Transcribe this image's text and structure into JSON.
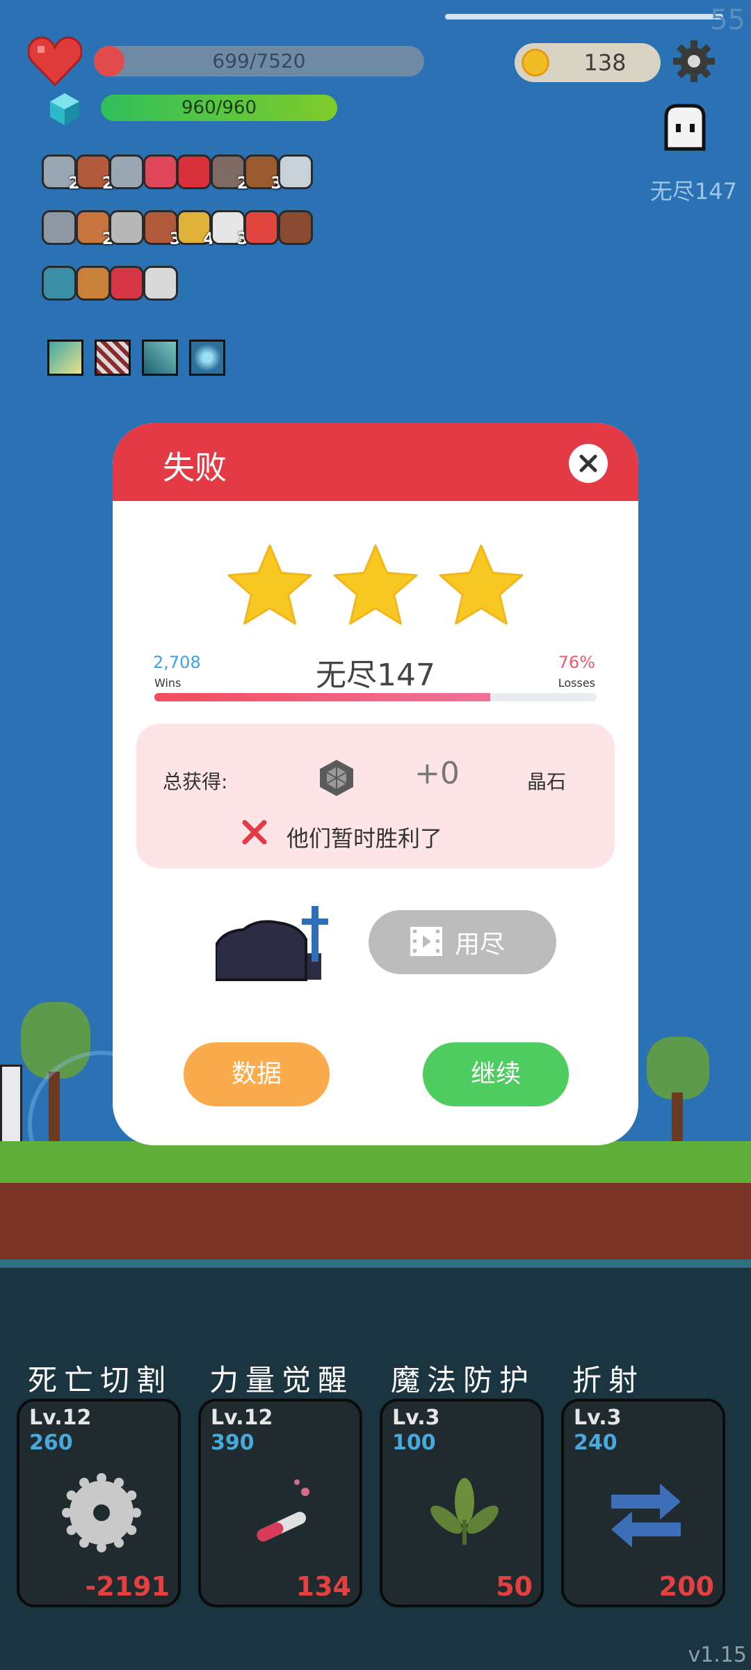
{
  "hud": {
    "fps": "55",
    "hp": {
      "text": "699/7520",
      "current": 699,
      "max": 7520,
      "color": "#e24b4b"
    },
    "mp": {
      "text": "960/960",
      "current": 960,
      "max": 960
    },
    "coins": "138",
    "level_name": "无尽147"
  },
  "items": {
    "row1": [
      {
        "icon": "sword-icon",
        "count": "2"
      },
      {
        "icon": "shield-icon",
        "count": "2"
      },
      {
        "icon": "sword-icon",
        "count": ""
      },
      {
        "icon": "watermelon-icon",
        "count": ""
      },
      {
        "icon": "apple-icon",
        "count": ""
      },
      {
        "icon": "mace-icon",
        "count": "2"
      },
      {
        "icon": "bow-icon",
        "count": "3"
      },
      {
        "icon": "arrow-icon",
        "count": ""
      }
    ],
    "row2": [
      {
        "icon": "axe-icon",
        "count": ""
      },
      {
        "icon": "bread-icon",
        "count": "2"
      },
      {
        "icon": "helmet-icon",
        "count": ""
      },
      {
        "icon": "shield-icon",
        "count": "3"
      },
      {
        "icon": "ring-icon",
        "count": "4"
      },
      {
        "icon": "dice-icon",
        "count": "3"
      },
      {
        "icon": "hearts-icon",
        "count": ""
      },
      {
        "icon": "door-icon",
        "count": ""
      }
    ],
    "row3": [
      {
        "icon": "potion-icon",
        "count": ""
      },
      {
        "icon": "meteor-icon",
        "count": ""
      },
      {
        "icon": "strawberry-icon",
        "count": ""
      },
      {
        "icon": "bulb-icon",
        "count": ""
      }
    ]
  },
  "modal": {
    "title": "失败",
    "stars": 3,
    "wins_value": "2,708",
    "wins_label": "Wins",
    "stage": "无尽147",
    "losses_value": "76%",
    "losses_label": "Losses",
    "progress": 0.76,
    "reward_label": "总获得:",
    "reward_amount": "+0",
    "reward_name": "晶石",
    "result_message": "他们暂时胜利了",
    "ad_button": "用尽",
    "data_button": "数据",
    "continue_button": "继续"
  },
  "skills": [
    {
      "title": "死亡切割",
      "level": "Lv.12",
      "cost": "260",
      "value": "-2191",
      "icon": "saw-blade-icon"
    },
    {
      "title": "力量觉醒",
      "level": "Lv.12",
      "cost": "390",
      "value": "134",
      "icon": "test-tube-icon"
    },
    {
      "title": "魔法防护",
      "level": "Lv.3",
      "cost": "100",
      "value": "50",
      "icon": "leaf-icon"
    },
    {
      "title": "折射",
      "level": "Lv.3",
      "cost": "240",
      "value": "200",
      "icon": "refract-arrows-icon"
    }
  ],
  "version": "v1.15"
}
